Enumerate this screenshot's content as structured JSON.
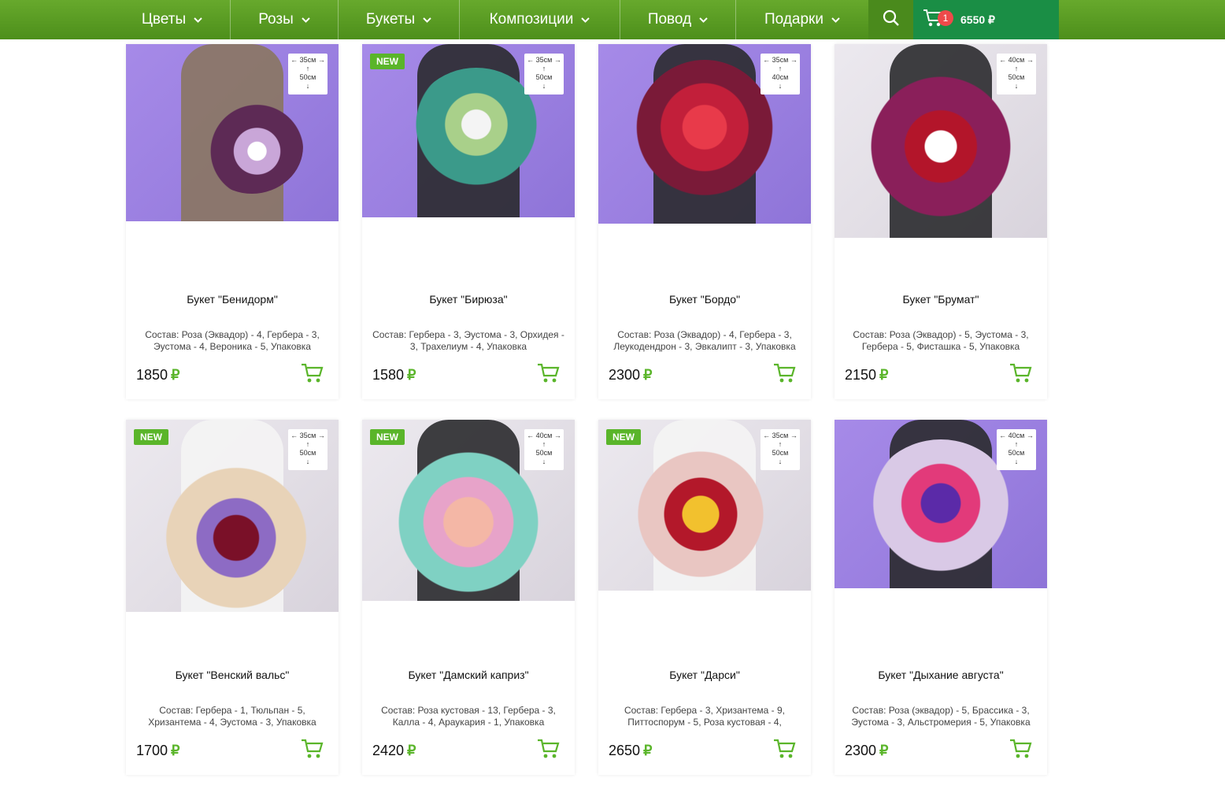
{
  "nav": {
    "items": [
      {
        "label": "Цветы"
      },
      {
        "label": "Розы"
      },
      {
        "label": "Букеты"
      },
      {
        "label": "Композиции"
      },
      {
        "label": "Повод"
      },
      {
        "label": "Подарки"
      }
    ]
  },
  "cart": {
    "count": "1",
    "total": "6550 ₽"
  },
  "currency_symbol": "₽",
  "colors": {
    "accent": "#5ab52a",
    "nav_bg": "#5a9d24",
    "cart_bg": "#1a8e45",
    "badge_red": "#ee4a4a"
  },
  "products": [
    {
      "title": "Букет \"Бенидорм\"",
      "composition": "Состав: Роза (Эквадор) - 4, Гербера - 3, Эустома - 4, Вероника - 5, Упаковка",
      "price": "1850",
      "size_w": "35см",
      "size_h": "50см",
      "is_new": false
    },
    {
      "title": "Букет \"Бирюза\"",
      "composition": "Состав: Гербера - 3, Эустома - 3, Орхидея - 3, Трахелиум - 4, Упаковка",
      "price": "1580",
      "size_w": "35см",
      "size_h": "50см",
      "is_new": true,
      "new_label": "NEW"
    },
    {
      "title": "Букет \"Бордо\"",
      "composition": "Состав: Роза (Эквадор) - 4, Гербера - 3, Леукодендрон - 3, Эвкалипт - 3, Упаковка",
      "price": "2300",
      "size_w": "35см",
      "size_h": "40см",
      "is_new": false
    },
    {
      "title": "Букет \"Брумат\"",
      "composition": "Состав: Роза (Эквадор) - 5, Эустома - 3, Гербера - 5, Фисташка - 5, Упаковка",
      "price": "2150",
      "size_w": "40см",
      "size_h": "50см",
      "is_new": false
    },
    {
      "title": "Букет \"Венский вальс\"",
      "composition": "Состав: Гербера - 1, Тюльпан - 5, Хризантема - 4, Эустома - 3, Упаковка",
      "price": "1700",
      "size_w": "35см",
      "size_h": "50см",
      "is_new": true,
      "new_label": "NEW"
    },
    {
      "title": "Букет \"Дамский каприз\"",
      "composition": "Состав: Роза кустовая - 13, Гербера - 3, Калла - 4, Араукария - 1, Упаковка",
      "price": "2420",
      "size_w": "40см",
      "size_h": "50см",
      "is_new": true,
      "new_label": "NEW"
    },
    {
      "title": "Букет \"Дарси\"",
      "composition": "Состав: Гербера - 3, Хризантема - 9, Питтоспорум - 5, Роза кустовая - 4,",
      "price": "2650",
      "size_w": "35см",
      "size_h": "50см",
      "is_new": true,
      "new_label": "NEW"
    },
    {
      "title": "Букет \"Дыхание августа\"",
      "composition": "Состав: Роза (эквадор) - 5, Брассика - 3, Эустома - 3, Альстромерия - 5, Упаковка",
      "price": "2300",
      "size_w": "40см",
      "size_h": "50см",
      "is_new": false
    }
  ]
}
